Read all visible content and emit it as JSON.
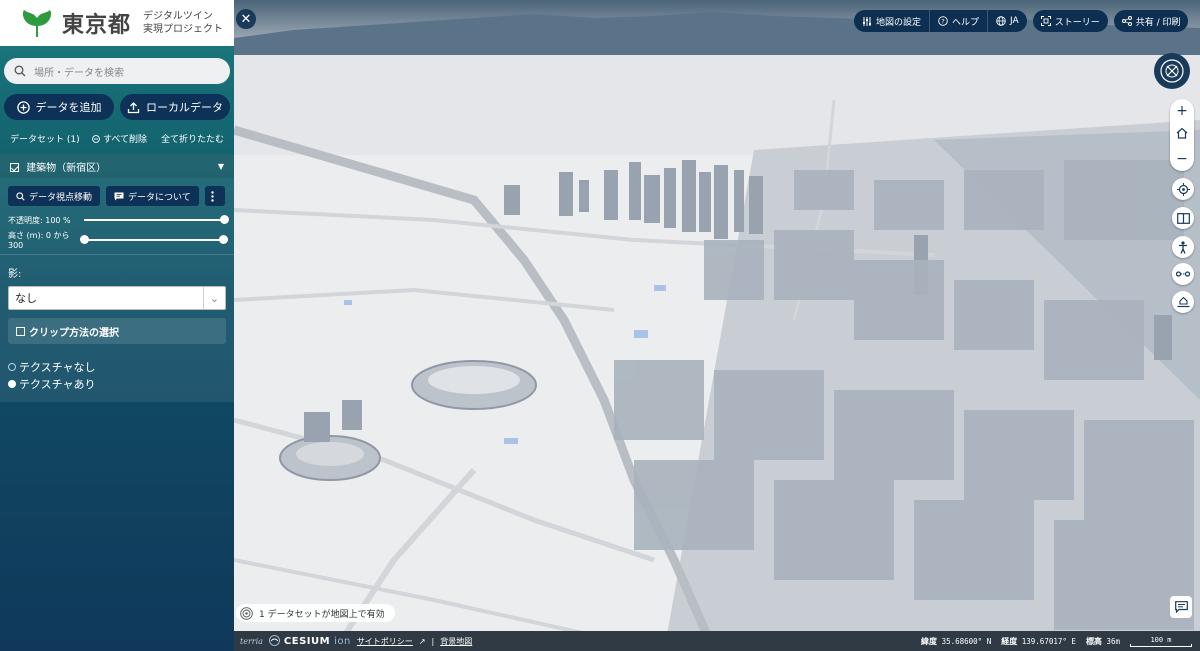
{
  "sidebar": {
    "logo_main": "東京都",
    "logo_sub_line1": "デジタルツイン",
    "logo_sub_line2": "実現プロジェクト",
    "search_placeholder": "場所・データを検索",
    "add_data_label": "データを追加",
    "local_data_label": "ローカルデータ",
    "dataset_count_label": "データセット (1)",
    "remove_all_label": "すべて削除",
    "collapse_all_label": "全て折りたたむ",
    "layer": {
      "title": "建築物（新宿区）",
      "checked": true,
      "zoom_to_label": "データ視点移動",
      "about_label": "データについて",
      "opacity_label": "不透明度: 100 %",
      "opacity_value": 1.0,
      "height_label": "高さ (m): 0 から 300",
      "height_min": 0,
      "height_max": 300
    },
    "shadow_label": "影:",
    "shadow_value": "なし",
    "clip_label": "クリップ方法の選択",
    "texture_options": [
      {
        "label": "テクスチャなし",
        "selected": false
      },
      {
        "label": "テクスチャあり",
        "selected": true
      }
    ]
  },
  "toolbar": {
    "map_settings": "地図の設定",
    "help": "ヘルプ",
    "language": "JA",
    "story": "ストーリー",
    "share": "共有 / 印刷"
  },
  "map": {
    "close_symbol": "✕",
    "dataset_note": "1 データセットが地図上で有効",
    "zoom_in": "+",
    "zoom_out": "−"
  },
  "bottom_bar": {
    "terria": "terria",
    "cesium_main": "CESIUM",
    "cesium_ion": "ion",
    "site_policy": "サイトポリシー",
    "separator": "|",
    "background_map": "背景地図",
    "lat_label": "緯度",
    "lat_value": "35.68600° N",
    "lon_label": "経度",
    "lon_value": "139.67017° E",
    "elev_label": "標高",
    "elev_value": "36m",
    "scale_label": "100 m"
  },
  "colors": {
    "sidebar_top": "#1e7d82",
    "sidebar_bottom": "#10385a",
    "dark_button": "#0d3157",
    "toolbar": "#0d2f52",
    "building": "#9aa6b2"
  }
}
